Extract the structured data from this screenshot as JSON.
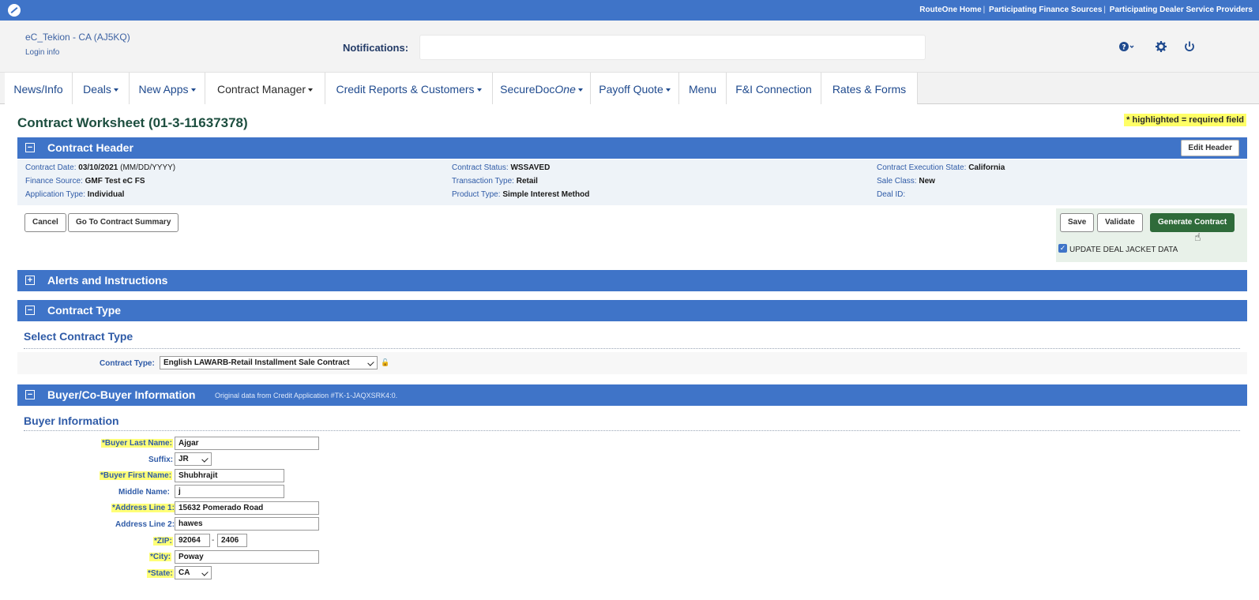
{
  "topbar": {
    "links": [
      "RouteOne Home",
      "Participating Finance Sources",
      "Participating Dealer Service Providers"
    ]
  },
  "header": {
    "account": "eC_Tekion - CA (AJ5KQ)",
    "login_info": "Login info",
    "notifications_label": "Notifications:",
    "notifications_value": "",
    "icons": [
      "help-icon",
      "gear-icon",
      "power-icon"
    ]
  },
  "nav": {
    "tabs": [
      {
        "label": "News/Info"
      },
      {
        "label": "Deals"
      },
      {
        "label": "New Apps"
      },
      {
        "label": "Contract Manager"
      },
      {
        "label": "Credit Reports & Customers"
      },
      {
        "label": "SecureDoc",
        "label_italic": "One"
      },
      {
        "label": "Payoff Quote"
      },
      {
        "label": "Menu"
      },
      {
        "label": "F&I Connection"
      },
      {
        "label": "Rates & Forms"
      }
    ]
  },
  "page": {
    "title": "Contract Worksheet (01-3-11637378)",
    "required_note": "* highlighted = required field"
  },
  "contract_header": {
    "title": "Contract Header",
    "edit_button": "Edit Header",
    "col1": [
      {
        "label": "Contract Date:",
        "value": "03/10/2021",
        "hint": "(MM/DD/YYYY)"
      },
      {
        "label": "Finance Source:",
        "value": "GMF Test eC FS"
      },
      {
        "label": "Application Type:",
        "value": "Individual"
      }
    ],
    "col2": [
      {
        "label": "Contract Status:",
        "value": "WSSAVED"
      },
      {
        "label": "Transaction Type:",
        "value": "Retail"
      },
      {
        "label": "Product Type:",
        "value": "Simple Interest Method"
      }
    ],
    "col3": [
      {
        "label": "Contract Execution State:",
        "value": "California"
      },
      {
        "label": "Sale Class:",
        "value": "New"
      },
      {
        "label": "Deal ID:",
        "value": ""
      }
    ]
  },
  "actions": {
    "cancel": "Cancel",
    "go_summary": "Go To Contract Summary",
    "save": "Save",
    "validate": "Validate",
    "generate": "Generate Contract",
    "update_deal_jacket": "UPDATE DEAL JACKET DATA",
    "update_deal_jacket_checked": true
  },
  "alerts": {
    "title": "Alerts and Instructions"
  },
  "contract_type": {
    "title": "Contract Type",
    "sub_heading": "Select Contract Type",
    "label": "Contract Type:",
    "value": "English LAWARB-Retail Installment Sale Contract"
  },
  "buyer": {
    "title": "Buyer/Co-Buyer Information",
    "source_note": "Original data from Credit Application #TK-1-JAQXSRK4:0.",
    "sub_heading": "Buyer Information",
    "fields": {
      "last_name": {
        "label": "*Buyer Last Name:",
        "value": "Ajgar"
      },
      "suffix": {
        "label": "Suffix:",
        "value": "JR"
      },
      "first_name": {
        "label": "*Buyer First Name:",
        "value": "Shubhrajit"
      },
      "middle_name": {
        "label": "Middle Name:",
        "value": "j"
      },
      "address1": {
        "label": "*Address Line 1:",
        "value": "15632 Pomerado Road"
      },
      "address2": {
        "label": "Address Line 2:",
        "value": "hawes"
      },
      "zip": {
        "label": "*ZIP:",
        "value": "92064",
        "ext": "2406"
      },
      "city": {
        "label": "*City:",
        "value": "Poway"
      },
      "state": {
        "label": "*State:",
        "value": "CA"
      }
    }
  },
  "colors": {
    "bar_blue": "#3f74c8",
    "title_green": "#1d4e3f",
    "button_green": "#2f6b3a",
    "required_yellow": "#ffff66"
  }
}
